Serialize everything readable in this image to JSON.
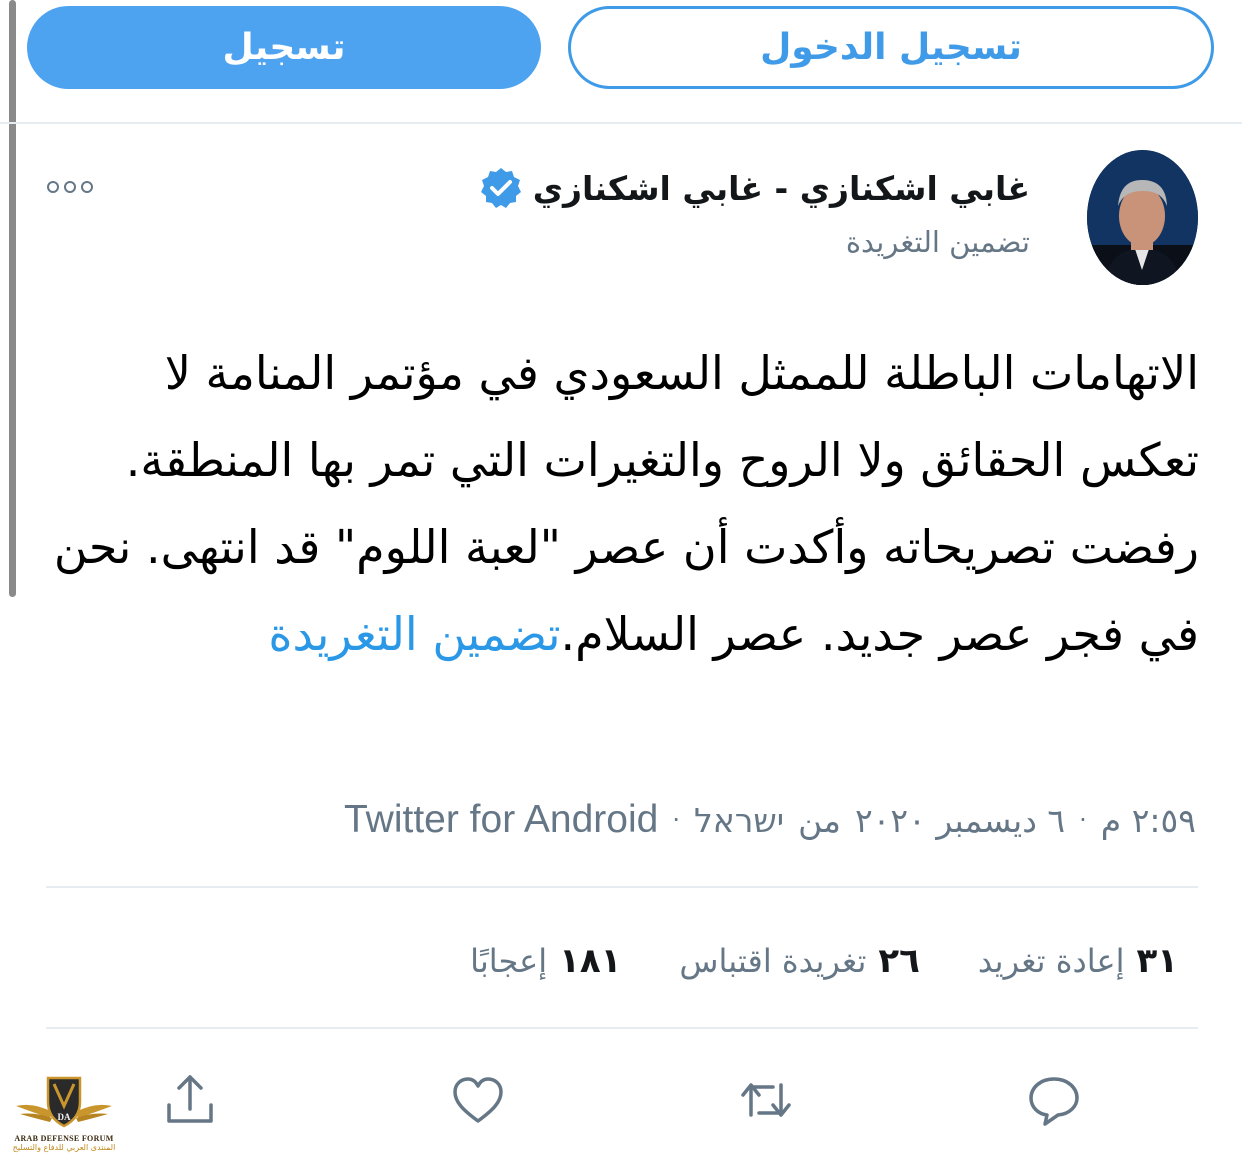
{
  "top_buttons": {
    "signup_label": "تسجيل",
    "login_label": "تسجيل الدخول"
  },
  "header": {
    "display_name": "غابي اشكنازي - غابي اشكنازي",
    "embed_label": "تضمين التغريدة",
    "avatar_icon": "user-photo",
    "verified_icon": "verified-badge-icon",
    "more_icon": "ellipsis-icon"
  },
  "tweet": {
    "text": "الاتهامات الباطلة للممثل السعودي في مؤتمر المنامة لا تعكس الحقائق ولا الروح والتغيرات التي تمر بها المنطقة. رفضت تصريحاته وأكدت أن عصر \"لعبة اللوم\" قد انتهى. نحن في فجر عصر جديد. عصر السلام.",
    "embed_link": "تضمين التغريدة"
  },
  "meta": {
    "time": "٢:٥٩ م",
    "date": "٦ ديسمبر ٢٠٢٠",
    "location_prefix": "من",
    "location": "ישראל",
    "source": "Twitter for Android"
  },
  "stats": {
    "retweets_count": "٣١",
    "retweets_label": "إعادة تغريد",
    "quotes_count": "٢٦",
    "quotes_label": "تغريدة اقتباس",
    "likes_count": "١٨١",
    "likes_label": "إعجابًا"
  },
  "actions": {
    "reply_icon": "reply-icon",
    "retweet_icon": "retweet-icon",
    "like_icon": "heart-icon",
    "share_icon": "share-icon"
  },
  "watermark": {
    "title": "ARAB DEFENSE FORUM",
    "subtitle": "المنتدى العربي للدفاع والتسليح"
  },
  "colors": {
    "accent": "#4da3f0",
    "link": "#2a98e6",
    "muted": "#657786",
    "divider": "#e6ecf0"
  }
}
